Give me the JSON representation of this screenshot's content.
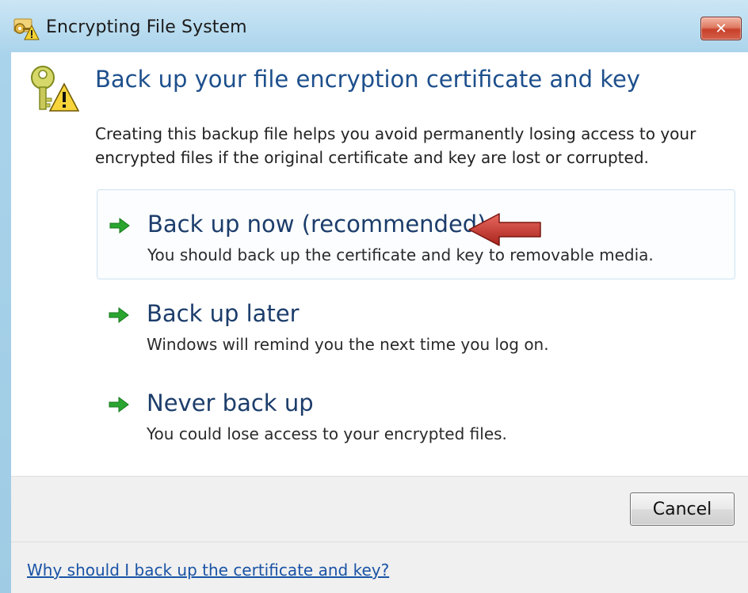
{
  "window": {
    "title": "Encrypting File System",
    "close_glyph": "✕"
  },
  "header": {
    "heading": "Back up your file encryption certificate and key",
    "description": "Creating this backup file helps you avoid permanently losing access to your encrypted files if the original certificate and key are lost or corrupted.",
    "icon": "key-warning-icon"
  },
  "options": [
    {
      "title": "Back up now (recommended)",
      "description": "You should back up the certificate and key to removable media.",
      "icon": "green-arrow-icon",
      "highlighted": true
    },
    {
      "title": "Back up later",
      "description": "Windows will remind you the next time you log on.",
      "icon": "green-arrow-icon",
      "highlighted": false
    },
    {
      "title": "Never back up",
      "description": "You could lose access to your encrypted files.",
      "icon": "green-arrow-icon",
      "highlighted": false
    }
  ],
  "footer": {
    "cancel_label": "Cancel",
    "help_link": "Why should I back up the certificate and key?"
  },
  "annotation": {
    "icon": "red-pointer-arrow-icon",
    "color": "#c0302a"
  },
  "colors": {
    "heading": "#1d4f8c",
    "link": "#1a53a5",
    "arrow_green": "#2aa630",
    "close_red": "#c8402a"
  }
}
